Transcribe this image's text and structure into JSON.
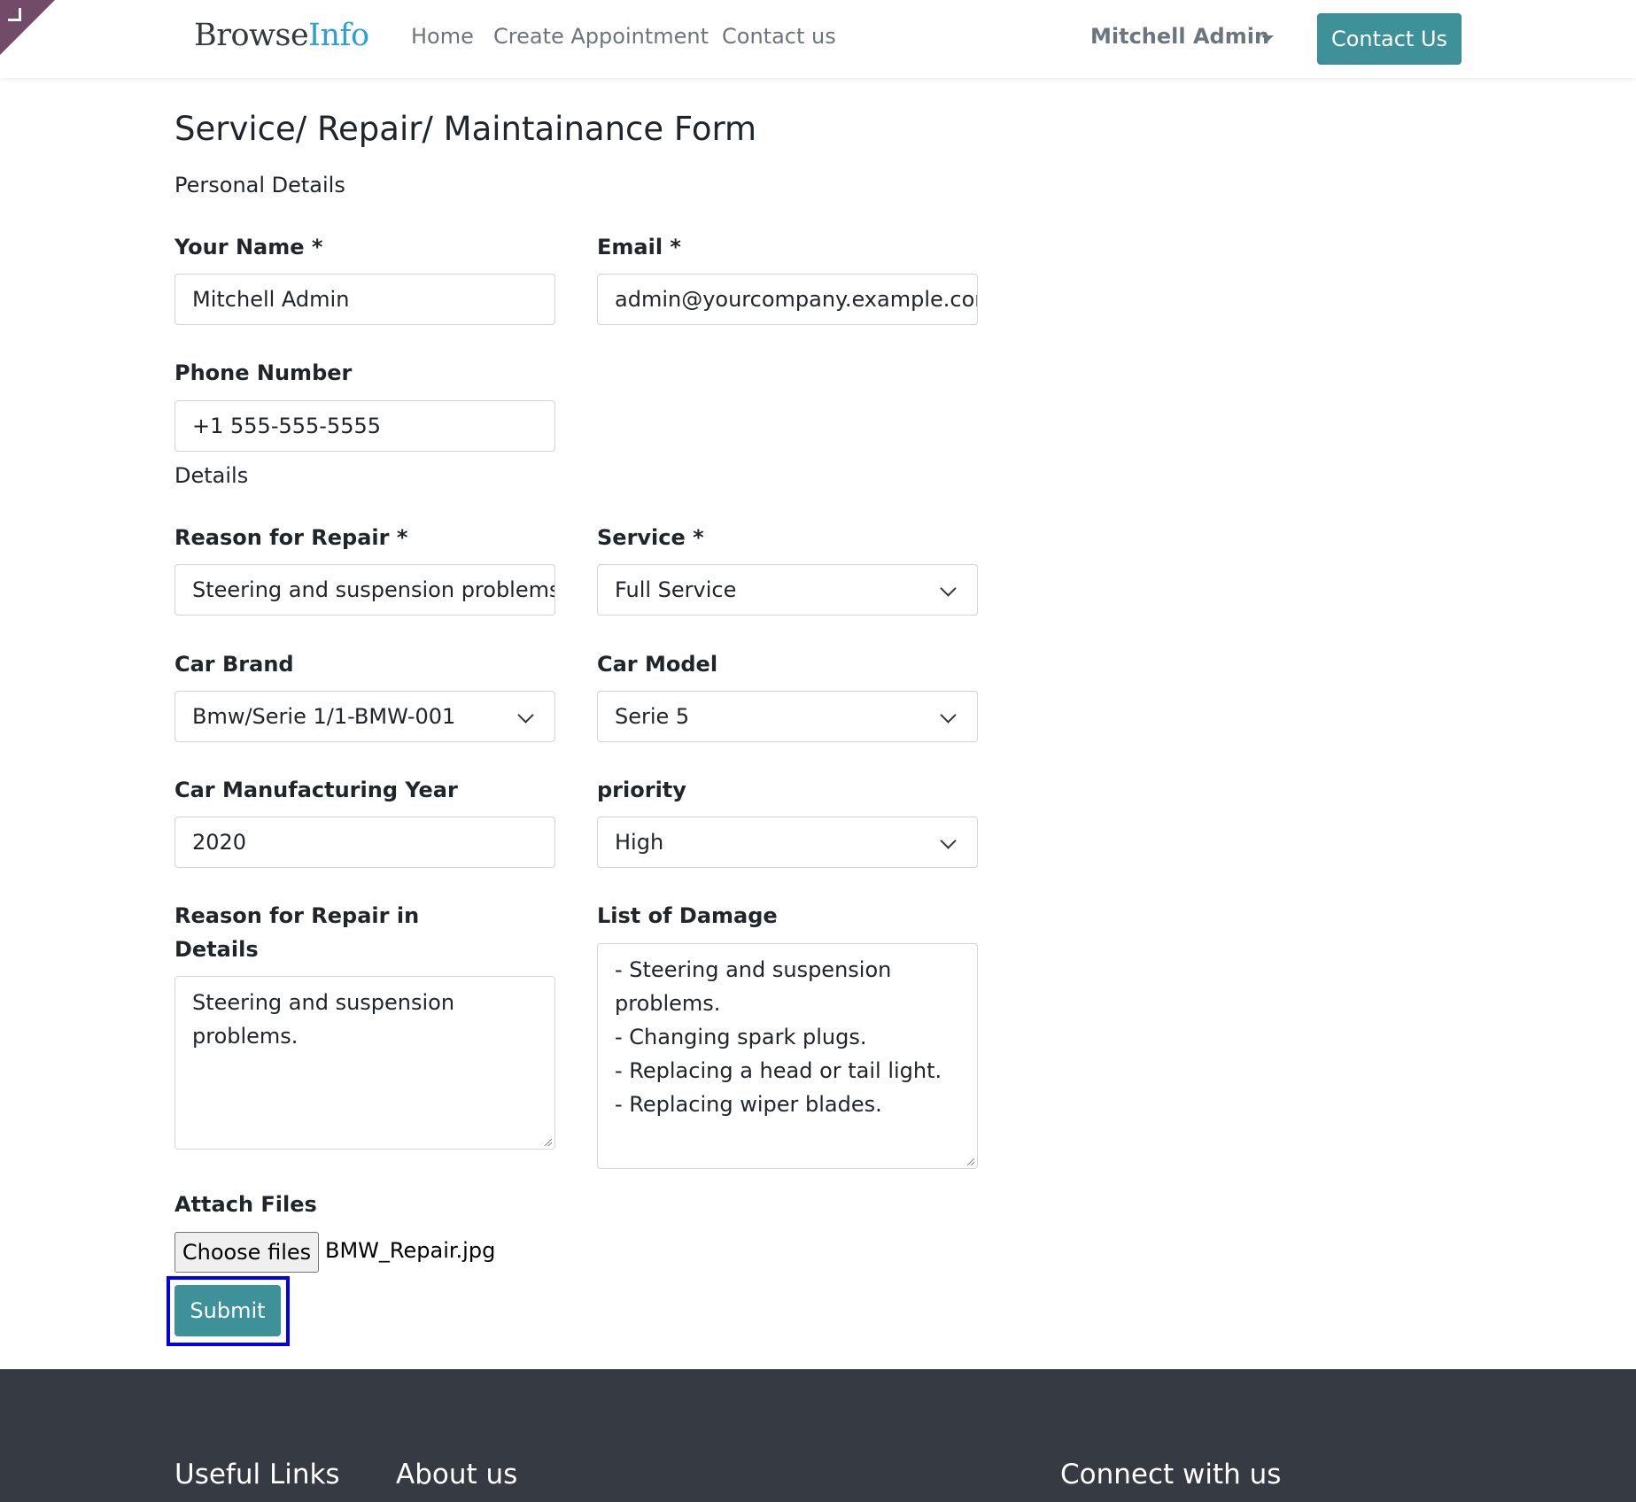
{
  "header": {
    "logo_main": "Browse",
    "logo_accent": "Info",
    "nav": [
      "Home",
      "Create Appointment",
      "Contact us"
    ],
    "user_name": "Mitchell Admin",
    "contact_button": "Contact Us"
  },
  "form": {
    "title": "Service/ Repair/ Maintainance Form",
    "personal_section": "Personal Details",
    "details_section": "Details",
    "name": {
      "label": "Your Name *",
      "value": "Mitchell Admin"
    },
    "email": {
      "label": "Email *",
      "value": "admin@yourcompany.example.com"
    },
    "phone": {
      "label": "Phone Number",
      "value": "+1 555-555-5555"
    },
    "reason": {
      "label": "Reason for Repair *",
      "value": "Steering and suspension problems"
    },
    "service": {
      "label": "Service *",
      "value": "Full Service"
    },
    "car_brand": {
      "label": "Car Brand",
      "value": "Bmw/Serie 1/1-BMW-001"
    },
    "car_model": {
      "label": "Car Model",
      "value": "Serie 5"
    },
    "year": {
      "label": "Car Manufacturing Year",
      "value": "2020"
    },
    "priority": {
      "label": "priority",
      "value": "High"
    },
    "reason_details": {
      "label_line1": "Reason for Repair in",
      "label_line2": "Details",
      "lines": [
        "Steering and suspension",
        "problems."
      ]
    },
    "damage": {
      "label": "List of Damage",
      "lines": [
        "- Steering and suspension",
        "problems.",
        "- Changing spark plugs.",
        "- Replacing a head or tail light.",
        "- Replacing wiper blades."
      ]
    },
    "attach": {
      "label": "Attach Files",
      "button": "Choose files",
      "file_name": "BMW_Repair.jpg"
    },
    "submit": "Submit"
  },
  "footer": {
    "useful_links": "Useful Links",
    "about_us": "About us",
    "connect": "Connect with us"
  },
  "colors": {
    "accent": "#3e9099",
    "footer_bg": "#363b43",
    "focus": "#0000ee"
  }
}
